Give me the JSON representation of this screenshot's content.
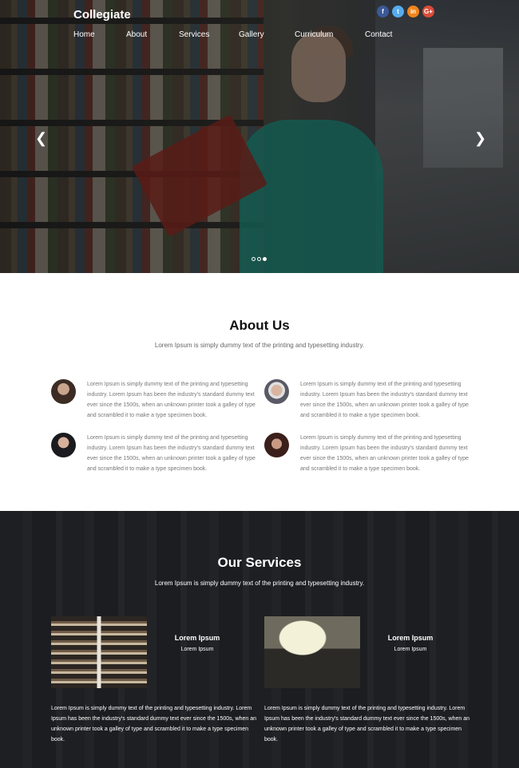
{
  "header": {
    "logo": "Collegiate",
    "social": [
      {
        "icon": "facebook-icon",
        "glyph": "f",
        "color": "#3b5998"
      },
      {
        "icon": "twitter-icon",
        "glyph": "t",
        "color": "#55acee"
      },
      {
        "icon": "linkedin-icon",
        "glyph": "in",
        "color": "#f0851d"
      },
      {
        "icon": "google-plus-icon",
        "glyph": "G+",
        "color": "#dd4b39"
      }
    ],
    "nav": [
      "Home",
      "About",
      "Services",
      "Gallery",
      "Curriculum",
      "Contact"
    ]
  },
  "hero": {
    "prev_icon": "chevron-left-icon",
    "next_icon": "chevron-right-icon",
    "slides": 3,
    "active_slide": 3
  },
  "about": {
    "title": "About Us",
    "subtitle": "Lorem Ipsum is simply dummy text of the printing and typesetting industry.",
    "people": [
      {
        "text": "Lorem Ipsum is simply dummy text of the printing and typesetting industry. Lorem Ipsum has been the industry's standard dummy text ever since the 1500s, when an unknown printer took a galley of type and scrambled it to make a type specimen book."
      },
      {
        "text": "Lorem Ipsum is simply dummy text of the printing and typesetting industry. Lorem Ipsum has been the industry's standard dummy text ever since the 1500s, when an unknown printer took a galley of type and scrambled it to make a type specimen book."
      },
      {
        "text": "Lorem Ipsum is simply dummy text of the printing and typesetting industry. Lorem Ipsum has been the industry's standard dummy text ever since the 1500s, when an unknown printer took a galley of type and scrambled it to make a type specimen book."
      },
      {
        "text": "Lorem Ipsum is simply dummy text of the printing and typesetting industry. Lorem Ipsum has been the industry's standard dummy text ever since the 1500s, when an unknown printer took a galley of type and scrambled it to make a type specimen book."
      }
    ]
  },
  "services": {
    "title": "Our Services",
    "subtitle": "Lorem Ipsum is simply dummy text of the printing and typesetting industry.",
    "items": [
      {
        "name": "Lorem Ipsum",
        "sub": "Lorem Ipsum",
        "desc": "Lorem Ipsum is simply dummy text of the printing and typesetting industry. Lorem Ipsum has been the industry's standard dummy text ever since the 1500s, when an unknown printer took a galley of type and scrambled it to make a type specimen book."
      },
      {
        "name": "Lorem Ipsum",
        "sub": "Lorem Ipsum",
        "desc": "Lorem Ipsum is simply dummy text of the printing and typesetting industry. Lorem Ipsum has been the industry's standard dummy text ever since the 1500s, when an unknown printer took a galley of type and scrambled it to make a type specimen book."
      }
    ]
  }
}
